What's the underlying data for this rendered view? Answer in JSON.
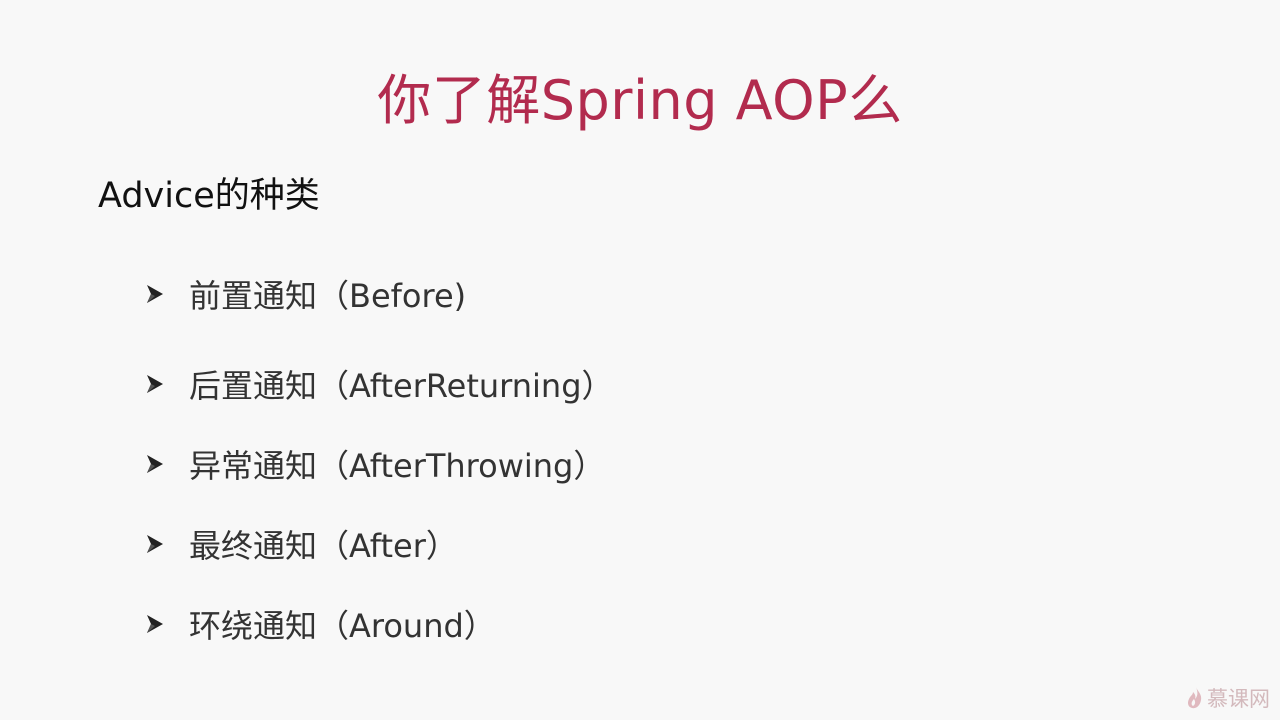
{
  "slide": {
    "title": "你了解Spring AOP么",
    "subtitle": "Advice的种类",
    "items": [
      {
        "label": "前置通知（Before)"
      },
      {
        "label": "后置通知（AfterReturning）"
      },
      {
        "label": "异常通知（AfterThrowing）"
      },
      {
        "label": "最终通知（After）"
      },
      {
        "label": "环绕通知（Around）"
      }
    ],
    "bullet_icon": "arrow-bullet-icon",
    "watermark": "慕课网",
    "colors": {
      "title": "#b22b4e",
      "background": "#f8f8f8",
      "text": "#333333"
    }
  }
}
